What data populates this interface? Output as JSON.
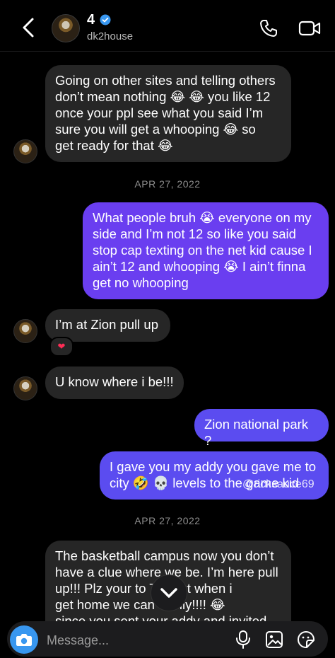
{
  "header": {
    "name": "4",
    "username": "dk2house"
  },
  "messages": [
    {
      "side": "in",
      "text": "Going on other sites and telling others\ndon’t mean nothing 😂 😂 you like 12\nonce your ppl see what you said I’m\nsure you will get a whooping 😂 so\nget ready for that 😂"
    },
    {
      "date": "APR 27, 2022"
    },
    {
      "side": "out",
      "text": "What people bruh 😭 everyone on my\nside and I’m not 12 so like you said\nstop cap texting on the net kid cause I\nain’t 12 and whooping 😭 I ain’t finna\nget no whooping"
    },
    {
      "side": "in",
      "text": "I’m at Zion pull up",
      "reaction": "❤"
    },
    {
      "side": "in",
      "text": "U know where i be!!!"
    },
    {
      "side": "out",
      "text": "Zion national park ?"
    },
    {
      "side": "out",
      "text": "I gave you my addy you gave me to\ncity 🤣 💀 levels to the game kid"
    },
    {
      "date": "APR 27, 2022"
    },
    {
      "side": "in",
      "text": "The basketball campus now you don’t\nhave a clue where we be. I’m here pull\nup!!! Plz your to      Tx. But when i\nget home we can      easily!!!! 😂\nsince you sent your addy and invited"
    }
  ],
  "watermark": "@ricksauce69",
  "composer": {
    "placeholder": "Message..."
  },
  "icons": {
    "back": "chevron-left-icon",
    "verified": "verified-badge-icon",
    "call": "phone-icon",
    "video": "video-camera-icon",
    "camera": "camera-icon",
    "mic": "microphone-icon",
    "gallery": "image-icon",
    "sticker": "sticker-icon",
    "scroll": "chevron-down-icon"
  },
  "colors": {
    "background": "#000000",
    "incoming_bubble": "#262626",
    "outgoing_bubble": "#5b4cf0",
    "accent_blue": "#3897f0",
    "reaction_heart": "#ff2d55"
  }
}
